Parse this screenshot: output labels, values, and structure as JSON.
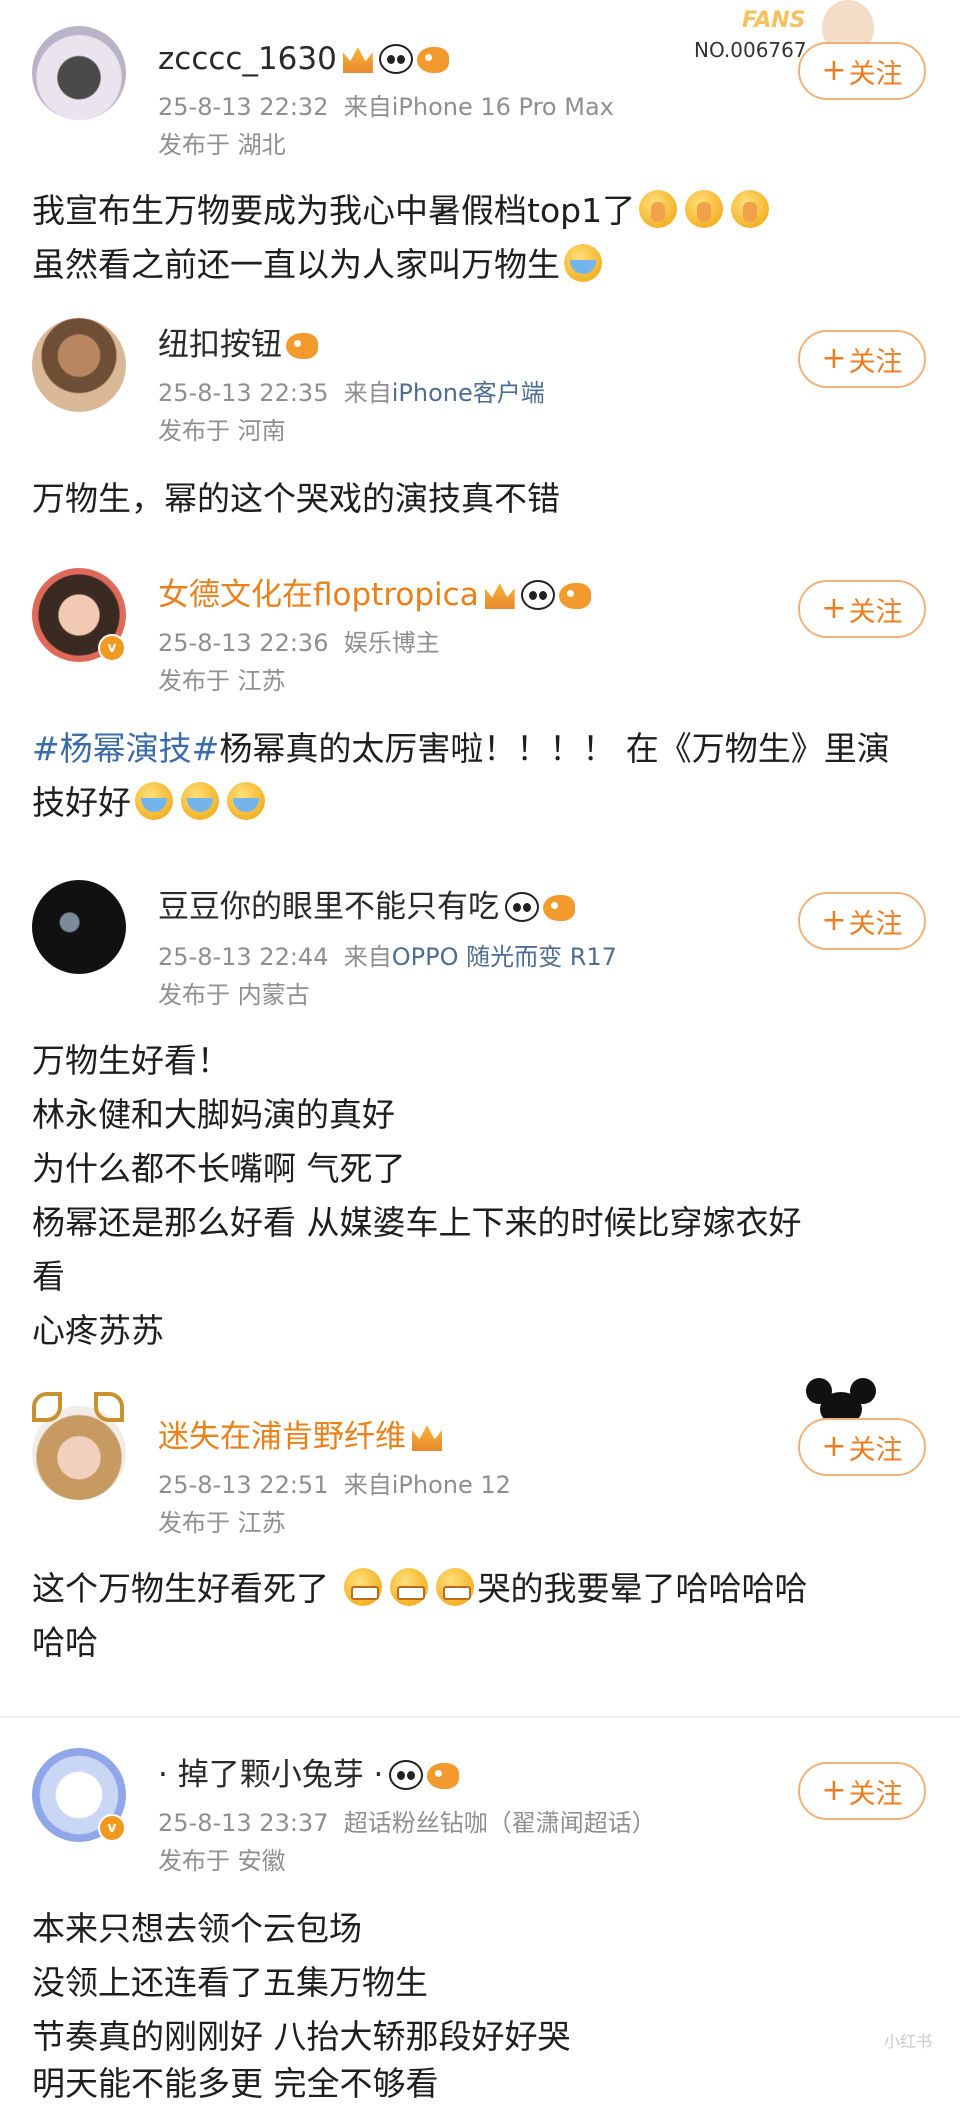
{
  "fans_card": {
    "title": "FANS",
    "number": "NO.006767"
  },
  "follow_label": "关注",
  "watermark": "小红书",
  "posts": [
    {
      "username": "zcccc_1630",
      "time": "25-8-13 22:32",
      "source_prefix": "来自",
      "source": "iPhone 16 Pro Max",
      "location_prefix": "发布于",
      "location": "湖北",
      "lines": [
        "我宣布生万物要成为我心中暑假档top1了",
        "虽然看之前还一直以为人家叫万物生"
      ]
    },
    {
      "username": "纽扣按钮",
      "time": "25-8-13 22:35",
      "source_prefix": "来自",
      "source": "iPhone客户端",
      "location_prefix": "发布于",
      "location": "河南",
      "lines": [
        "万物生，幂的这个哭戏的演技真不错"
      ]
    },
    {
      "username": "女德文化在floptropica",
      "time": "25-8-13 22:36",
      "tagline": "娱乐博主",
      "location_prefix": "发布于",
      "location": "江苏",
      "hashtag": "#杨幂演技#",
      "lines": [
        "杨幂真的太厉害啦！！！！ 在《万物生》里演",
        "技好好"
      ]
    },
    {
      "username": "豆豆你的眼里不能只有吃",
      "time": "25-8-13 22:44",
      "source_prefix": "来自",
      "source": "OPPO 随光而变 R17",
      "location_prefix": "发布于",
      "location": "内蒙古",
      "lines": [
        "万物生好看！",
        "林永健和大脚妈演的真好",
        "为什么都不长嘴啊 气死了",
        "杨幂还是那么好看 从媒婆车上下来的时候比穿嫁衣好",
        "看",
        "心疼苏苏"
      ]
    },
    {
      "username": "迷失在浦肯野纤维",
      "time": "25-8-13 22:51",
      "source_prefix": "来自",
      "source": "iPhone 12",
      "location_prefix": "发布于",
      "location": "江苏",
      "lines": [
        "这个万物生好看死了",
        "哭的我要晕了哈哈哈哈",
        "哈哈"
      ]
    },
    {
      "username": "· 掉了颗小兔芽 ·",
      "time": "25-8-13 23:37",
      "tagline": "超话粉丝钻咖（翟潇闻超话）",
      "location_prefix": "发布于",
      "location": "安徽",
      "lines": [
        "本来只想去领个云包场",
        "没领上还连看了五集万物生",
        "节奏真的刚刚好 八抬大轿那段好好哭",
        "明天能不能多更 完全不够看"
      ]
    }
  ]
}
